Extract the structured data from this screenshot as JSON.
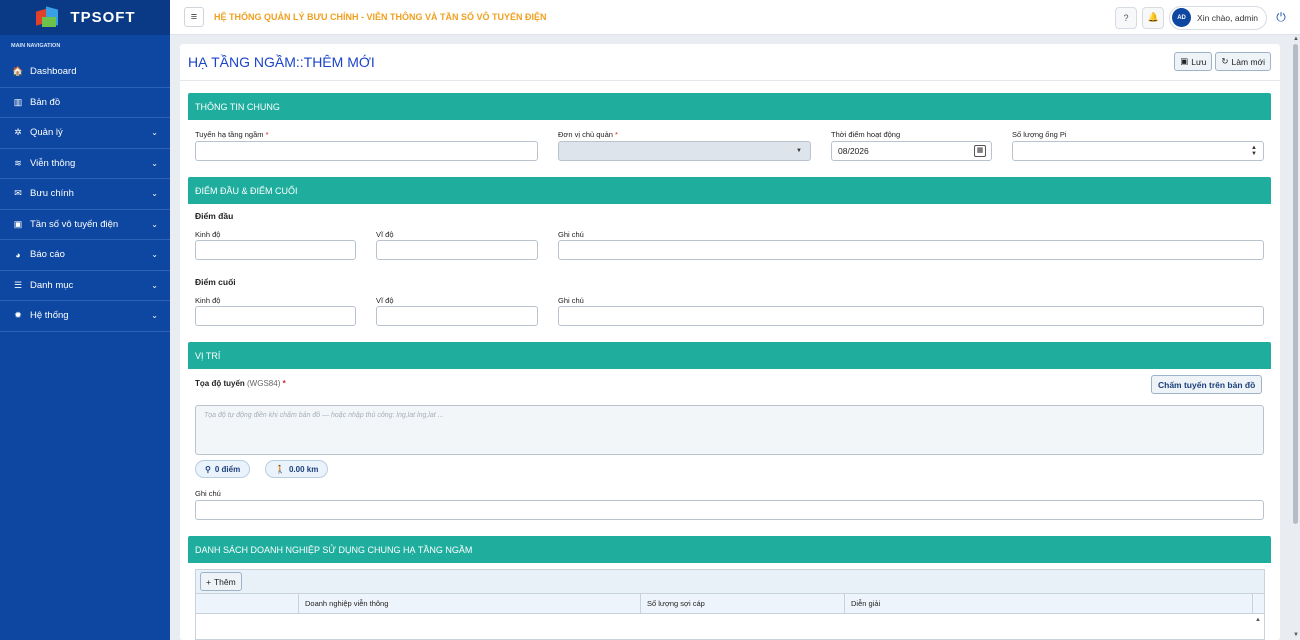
{
  "brand": {
    "logo_text": "TPSOFT"
  },
  "sidebar": {
    "header": "MAIN NAVIGATION",
    "items": [
      {
        "label": "Dashboard",
        "icon": "home-icon",
        "glyph": "🏠",
        "has_children": false
      },
      {
        "label": "Bản đồ",
        "icon": "map-icon",
        "glyph": "▥",
        "has_children": false
      },
      {
        "label": "Quản lý",
        "icon": "gears-icon",
        "glyph": "✲",
        "has_children": true
      },
      {
        "label": "Viễn thông",
        "icon": "wifi-icon",
        "glyph": "≋",
        "has_children": true
      },
      {
        "label": "Bưu chính",
        "icon": "envelope-icon",
        "glyph": "✉",
        "has_children": true
      },
      {
        "label": "Tần số vô tuyến điện",
        "icon": "id-card-icon",
        "glyph": "▣",
        "has_children": true
      },
      {
        "label": "Báo cáo",
        "icon": "pie-chart-icon",
        "glyph": "◕",
        "has_children": true
      },
      {
        "label": "Danh mục",
        "icon": "list-icon",
        "glyph": "☰",
        "has_children": true
      },
      {
        "label": "Hệ thống",
        "icon": "cog-icon",
        "glyph": "✹",
        "has_children": true
      }
    ]
  },
  "topbar": {
    "title": "HỆ THỐNG QUẢN LÝ BƯU CHÍNH - VIỄN THÔNG VÀ TẦN SỐ VÔ TUYẾN ĐIỆN",
    "avatar_initials": "AD",
    "greeting": "Xin chào, admin"
  },
  "page": {
    "title": "HẠ TẦNG NGẦM::THÊM MỚI",
    "save_label": "Lưu",
    "reset_label": "Làm mới"
  },
  "general": {
    "section_title": "THÔNG TIN CHUNG",
    "route_label": "Tuyến hạ tầng ngầm",
    "owner_label": "Đơn vị chủ quản",
    "time_label": "Thời điểm hoạt động",
    "time_value": "08/2026",
    "pipe_label": "Số lượng ống Pi"
  },
  "endpoints": {
    "section_title": "ĐIỂM ĐẦU & ĐIỂM CUỐI",
    "start_heading": "Điểm đầu",
    "end_heading": "Điểm cuối",
    "lng_label": "Kinh độ",
    "lat_label": "Vĩ độ",
    "note_label": "Ghi chú"
  },
  "location": {
    "section_title": "VỊ TRÍ",
    "coords_label": "Tọa độ tuyến",
    "coords_hint": "(WGS84)",
    "draw_button": "Chấm tuyến trên bản đồ",
    "coords_placeholder": "Tọa độ tự động điền khi chấm bản đồ — hoặc nhập thủ công: lng,lat lng,lat ...",
    "points_count": "0 điểm",
    "distance": "0.00 km",
    "note_label": "Ghi chú"
  },
  "shared": {
    "section_title": "DANH SÁCH DOANH NGHIỆP SỬ DỤNG CHUNG HẠ TẦNG NGẦM",
    "add_label": "Thêm",
    "columns": [
      "",
      "Doanh nghiệp viễn thông",
      "Số lượng sợi cáp",
      "Diễn giải"
    ]
  }
}
